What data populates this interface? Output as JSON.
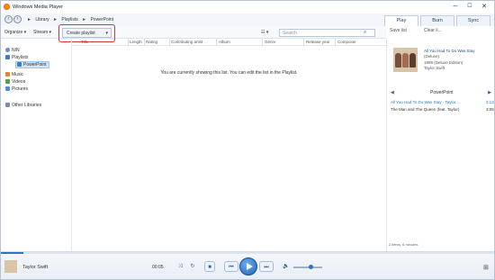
{
  "app": {
    "title": "Windows Media Player"
  },
  "window_controls": {
    "minimize": "─",
    "maximize": "☐",
    "close": "✕"
  },
  "nav": {
    "back": "‹",
    "forward": "›",
    "crumbs": [
      "Library",
      "Playlists",
      "PowerPoint"
    ]
  },
  "tabs": [
    {
      "label": "Play"
    },
    {
      "label": "Burn"
    },
    {
      "label": "Sync"
    }
  ],
  "toolbar": {
    "organize": "Organize ▾",
    "stream": "Stream ▾",
    "create_playlist": "Create playlist",
    "create_playlist_arrow": "▾",
    "view_options": "☷ ▾",
    "search_placeholder": "Search",
    "search_icon": "⌕",
    "save_list": "Save list",
    "clear_list": "Clear li..."
  },
  "columns": [
    "Title",
    "Length",
    "Rating",
    "Contributing artist",
    "Album",
    "Genre",
    "Release year",
    "Composer"
  ],
  "sidebar": {
    "items": [
      {
        "label": "NIN",
        "icon": "person-icon"
      },
      {
        "label": "Playlists",
        "icon": "playlist-icon"
      },
      {
        "label": "PowerPoint",
        "icon": "playlist-icon"
      },
      {
        "label": "Music",
        "icon": "music-icon"
      },
      {
        "label": "Videos",
        "icon": "video-icon"
      },
      {
        "label": "Pictures",
        "icon": "picture-icon"
      },
      {
        "label": "Other Libraries",
        "icon": "library-icon"
      }
    ]
  },
  "main": {
    "empty_message": "You are currently showing this list. You can edit the list in the Playlist."
  },
  "right_pane": {
    "album_title": "All You Had To Do Was Stay",
    "album_line2": "(Deluxe)",
    "album_line3": "1989 (Deluxe Edition)",
    "album_line4": "Taylor Swift",
    "playlist_label": "PowerPoint",
    "prev_arrow": "◀",
    "next_arrow": "▶",
    "tracks": [
      {
        "title": "All You Had To Do Was Stay - Taylor...",
        "length": "3:13",
        "active": true
      },
      {
        "title": "The Man and The Queen (feat. Taylor)",
        "length": "3:05",
        "active": false
      }
    ],
    "footer": "2 items, 6 minutes"
  },
  "player": {
    "artist": "Taylor Swift",
    "time": "00:05",
    "shuffle": "⤨",
    "repeat": "↻",
    "stop": "■",
    "prev": "⏮",
    "next": "⏭",
    "mute": "🔈",
    "switch_view": "⊞",
    "progress_fraction": 0.045,
    "volume_fraction": 0.6
  },
  "colors": {
    "accent": "#2d72c4",
    "highlight": "#e0342f",
    "selection": "#cce4f7"
  }
}
